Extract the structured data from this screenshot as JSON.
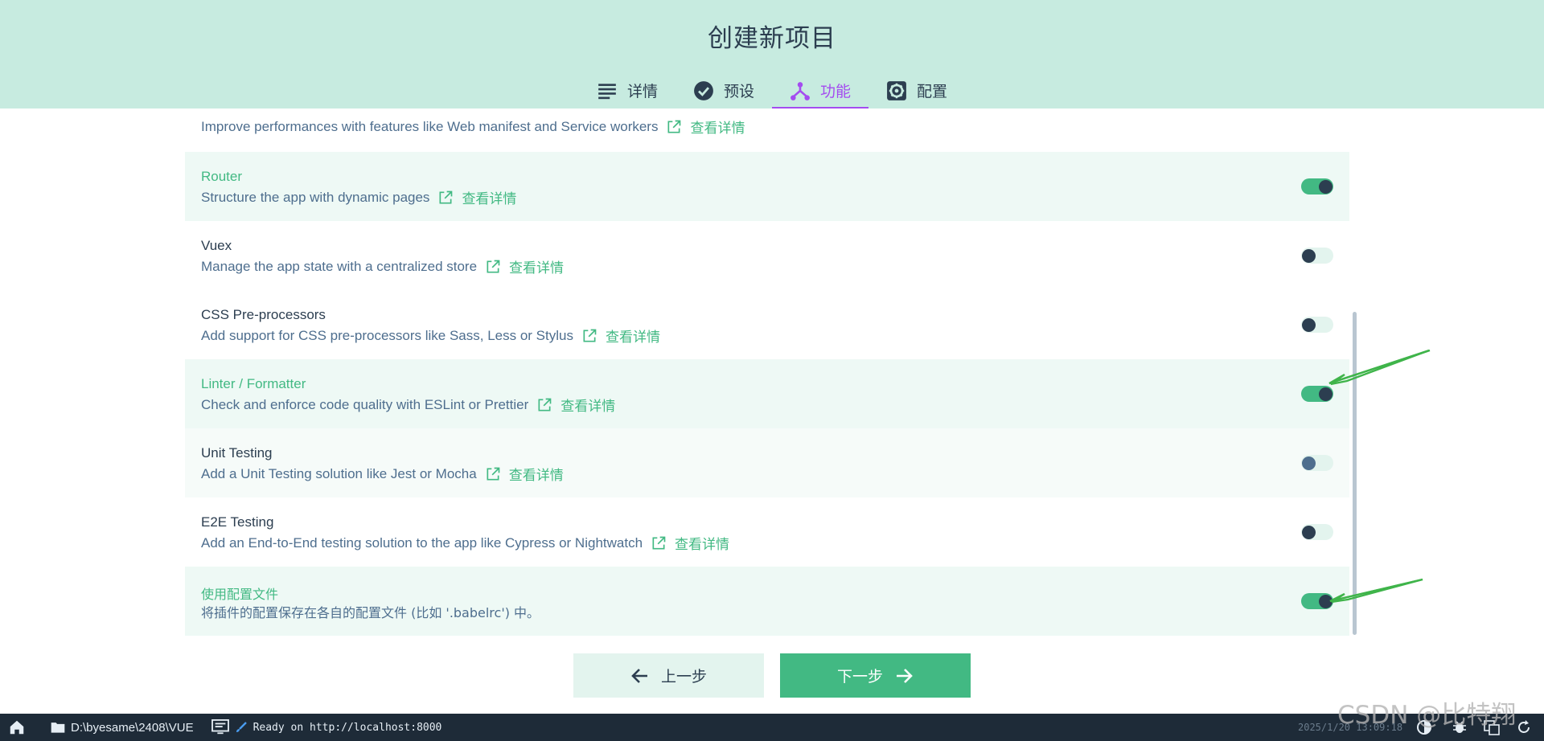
{
  "header": {
    "title": "创建新项目",
    "tabs": [
      {
        "label": "详情",
        "icon": "list-icon",
        "active": false
      },
      {
        "label": "预设",
        "icon": "check-circle-icon",
        "active": false
      },
      {
        "label": "功能",
        "icon": "fork-icon",
        "active": true
      },
      {
        "label": "配置",
        "icon": "gear-icon",
        "active": false
      }
    ]
  },
  "features": {
    "partial_desc": "Improve performances with features like Web manifest and Service workers",
    "more_link": "查看详情",
    "items": [
      {
        "name": "Router",
        "desc": "Structure the app with dynamic pages",
        "enabled": true
      },
      {
        "name": "Vuex",
        "desc": "Manage the app state with a centralized store",
        "enabled": false
      },
      {
        "name": "CSS Pre-processors",
        "desc": "Add support for CSS pre-processors like Sass, Less or Stylus",
        "enabled": false
      },
      {
        "name": "Linter / Formatter",
        "desc": "Check and enforce code quality with ESLint or Prettier",
        "enabled": true
      },
      {
        "name": "Unit Testing",
        "desc": "Add a Unit Testing solution like Jest or Mocha",
        "enabled": false
      },
      {
        "name": "E2E Testing",
        "desc": "Add an End-to-End testing solution to the app like Cypress or Nightwatch",
        "enabled": false
      }
    ],
    "config_files": {
      "name": "使用配置文件",
      "desc": "将插件的配置保存在各自的配置文件 (比如 '.babelrc') 中。",
      "enabled": true
    }
  },
  "buttons": {
    "prev": "上一步",
    "next": "下一步"
  },
  "statusbar": {
    "path": "D:\\byesame\\2408\\VUE",
    "log": "Ready on http://localhost:8000",
    "time": "2025/1/20 13:09:18"
  },
  "watermark": "CSDN @比特翔",
  "colors": {
    "accent": "#42b983",
    "active_tab": "#a44cf0",
    "header_bg": "#c7ebe0",
    "statusbar_bg": "#1e2b38"
  }
}
